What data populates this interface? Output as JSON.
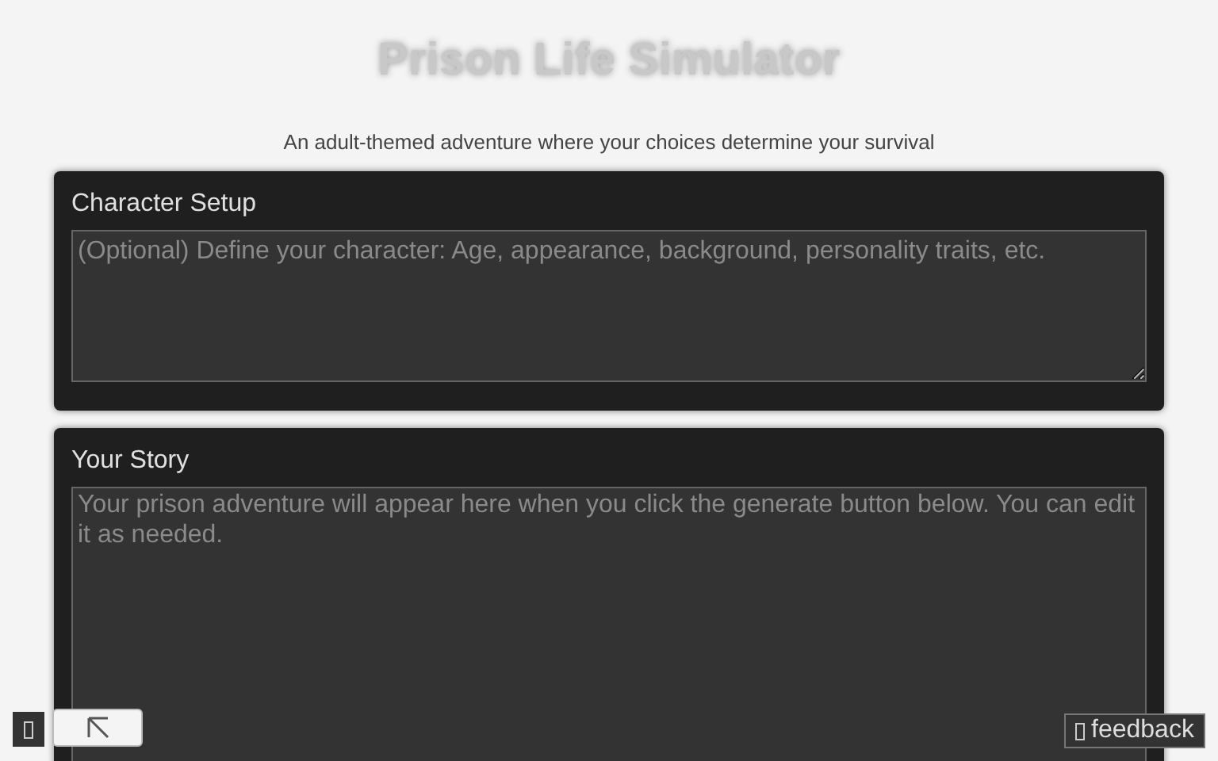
{
  "title": "Prison Life Simulator",
  "subtitle": "An adult-themed adventure where your choices determine your survival",
  "sections": [
    {
      "label": "Character Setup",
      "placeholder": "(Optional) Define your character: Age, appearance, background, personality traits, etc."
    },
    {
      "label": "Your Story",
      "placeholder": "Your prison adventure will appear here when you click the generate button below. You can edit it as needed."
    }
  ],
  "feedback": {
    "label": "feedback"
  }
}
